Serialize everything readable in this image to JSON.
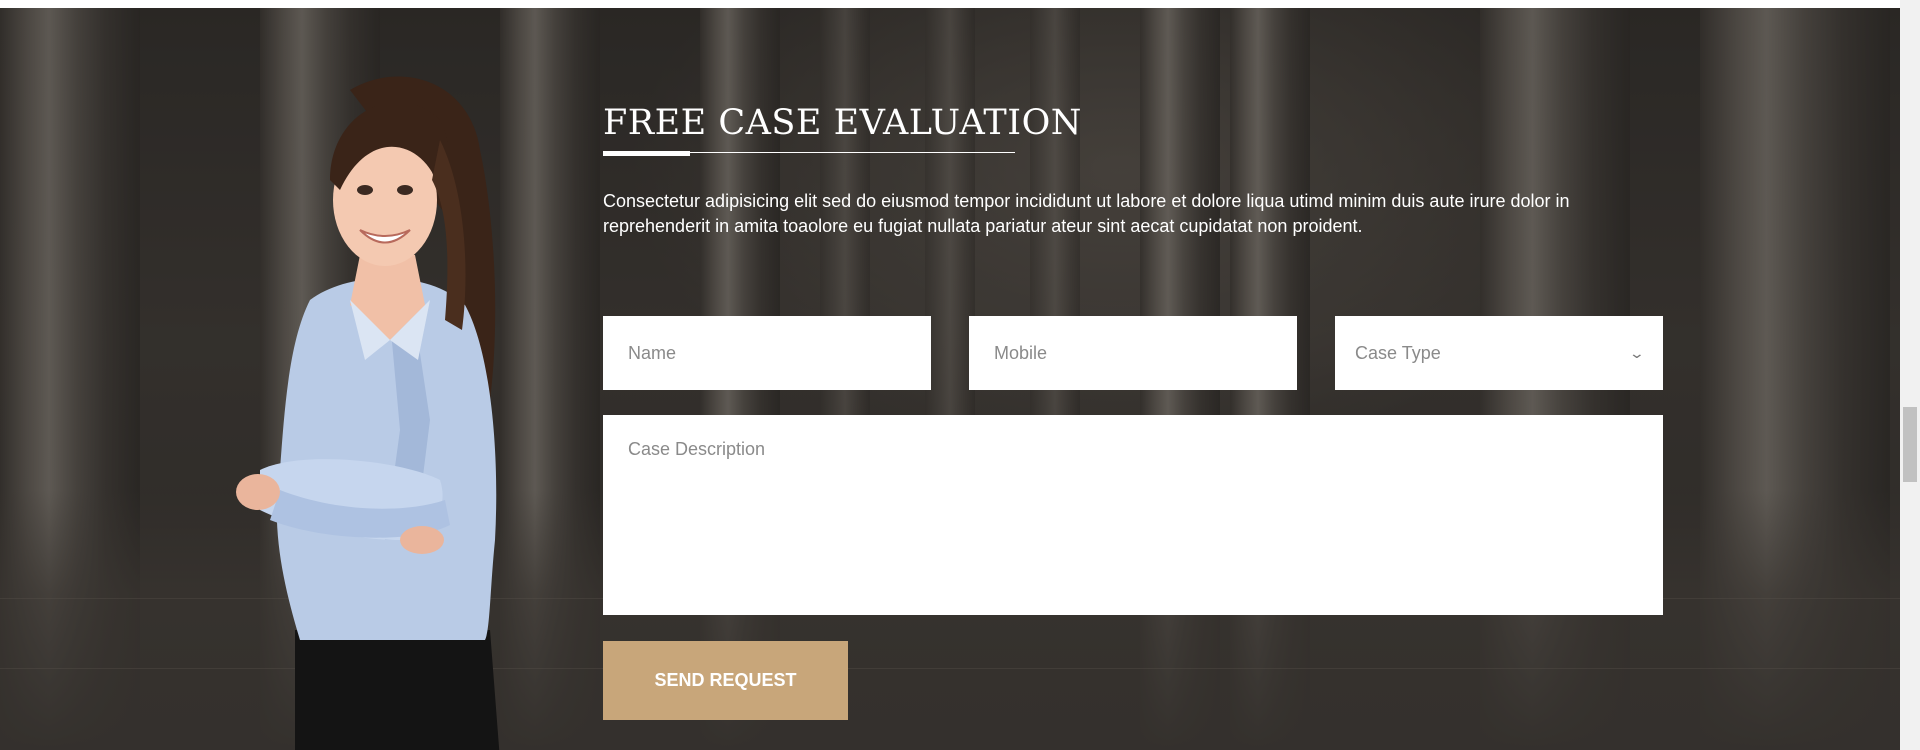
{
  "section": {
    "title": "FREE CASE EVALUATION",
    "intro": "Consectetur adipisicing elit sed do eiusmod tempor incididunt ut labore et dolore liqua utimd minim duis aute irure dolor in reprehenderit in amita toaolore eu fugiat nullata pariatur ateur sint aecat cupidatat non proident."
  },
  "form": {
    "name_placeholder": "Name",
    "mobile_placeholder": "Mobile",
    "case_type": {
      "selected": "Case Type"
    },
    "description_placeholder": "Case Description",
    "submit_label": "SEND REQUEST"
  },
  "icons": {
    "select_chevron": "chevron-down-icon"
  },
  "colors": {
    "accent": "#c8a67a",
    "text": "#ffffff",
    "field_bg": "#ffffff"
  }
}
